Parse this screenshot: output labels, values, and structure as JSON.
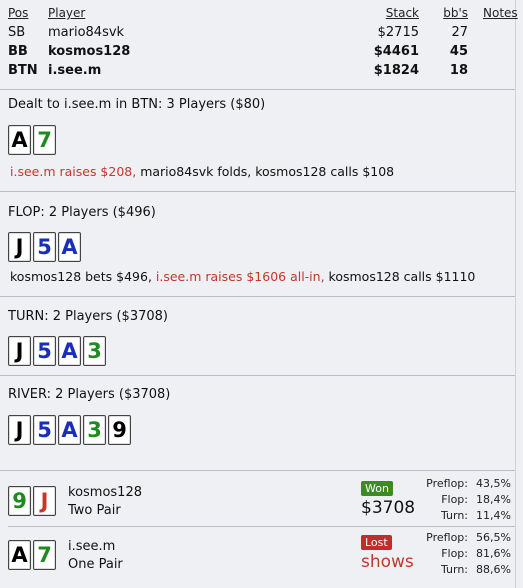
{
  "table": {
    "headers": {
      "pos": "Pos",
      "player": "Player",
      "stack": "Stack",
      "bbs": "bb's",
      "notes": "Notes"
    },
    "rows": [
      {
        "pos": "SB",
        "player": "mario84svk",
        "stack": "$2715",
        "bbs": "27",
        "bold": false
      },
      {
        "pos": "BB",
        "player": "kosmos128",
        "stack": "$4461",
        "bbs": "45",
        "bold": true
      },
      {
        "pos": "BTN",
        "player": "i.see.m",
        "stack": "$1824",
        "bbs": "18",
        "bold": true
      }
    ]
  },
  "preflop": {
    "title": "Dealt to i.see.m in BTN: 3 Players ($80)",
    "cards": [
      {
        "rank": "A",
        "suit_color": "black"
      },
      {
        "rank": "7",
        "suit_color": "green"
      }
    ],
    "action_red": "i.see.m raises $208,",
    "action_rest": " mario84svk folds, kosmos128 calls $108"
  },
  "flop": {
    "title": "FLOP: 2 Players ($496)",
    "cards": [
      {
        "rank": "J",
        "suit_color": "black"
      },
      {
        "rank": "5",
        "suit_color": "blue"
      },
      {
        "rank": "A",
        "suit_color": "blue"
      }
    ],
    "action_pre": "kosmos128 bets $496, ",
    "action_red": "i.see.m raises $1606 all-in,",
    "action_post": " kosmos128 calls $1110"
  },
  "turn": {
    "title": "TURN: 2 Players ($3708)",
    "cards": [
      {
        "rank": "J",
        "suit_color": "black"
      },
      {
        "rank": "5",
        "suit_color": "blue"
      },
      {
        "rank": "A",
        "suit_color": "blue"
      },
      {
        "rank": "3",
        "suit_color": "green"
      }
    ]
  },
  "river": {
    "title": "RIVER: 2 Players ($3708)",
    "cards": [
      {
        "rank": "J",
        "suit_color": "black"
      },
      {
        "rank": "5",
        "suit_color": "blue"
      },
      {
        "rank": "A",
        "suit_color": "blue"
      },
      {
        "rank": "3",
        "suit_color": "green"
      },
      {
        "rank": "9",
        "suit_color": "black"
      }
    ]
  },
  "showdown": [
    {
      "player": "kosmos128",
      "hand": "Two Pair",
      "cards": [
        {
          "rank": "9",
          "suit_color": "green"
        },
        {
          "rank": "J",
          "suit_color": "red"
        }
      ],
      "result": "Won",
      "amount": "$3708",
      "equity": [
        {
          "label": "Preflop:",
          "value": "43,5%"
        },
        {
          "label": "Flop:",
          "value": "18,4%"
        },
        {
          "label": "Turn:",
          "value": "11,4%"
        }
      ]
    },
    {
      "player": "i.see.m",
      "hand": "One Pair",
      "cards": [
        {
          "rank": "A",
          "suit_color": "black"
        },
        {
          "rank": "7",
          "suit_color": "green"
        }
      ],
      "result": "Lost",
      "amount": "shows",
      "equity": [
        {
          "label": "Preflop:",
          "value": "56,5%"
        },
        {
          "label": "Flop:",
          "value": "81,6%"
        },
        {
          "label": "Turn:",
          "value": "88,6%"
        }
      ]
    }
  ],
  "colors": {
    "black": "#000000",
    "green": "#1f8a1f",
    "blue": "#1a2fb8",
    "red": "#c0392b",
    "won": "#3e8a24",
    "lost": "#c22c2c"
  }
}
